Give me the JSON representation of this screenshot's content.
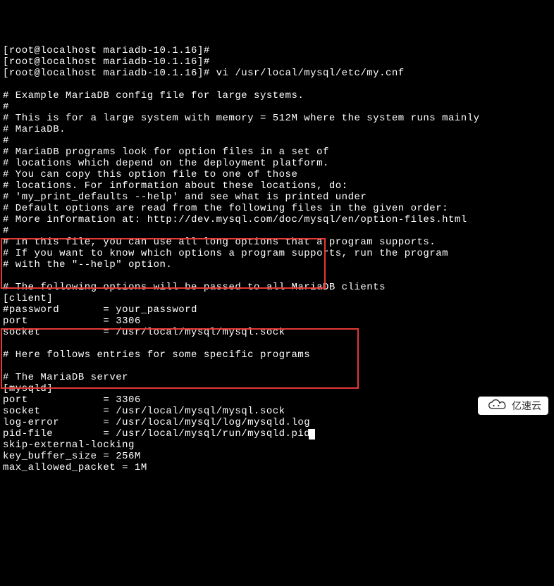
{
  "prompt": {
    "p0": "[root@localhost mariadb-10.1.16]#",
    "p1": "[root@localhost mariadb-10.1.16]#",
    "p2": "[root@localhost mariadb-10.1.16]# vi /usr/local/mysql/etc/my.cnf"
  },
  "file": {
    "l00": "",
    "l01": "# Example MariaDB config file for large systems.",
    "l02": "#",
    "l03": "# This is for a large system with memory = 512M where the system runs mainly",
    "l04": "# MariaDB.",
    "l05": "#",
    "l06": "# MariaDB programs look for option files in a set of",
    "l07": "# locations which depend on the deployment platform.",
    "l08": "# You can copy this option file to one of those",
    "l09": "# locations. For information about these locations, do:",
    "l10": "# 'my_print_defaults --help' and see what is printed under",
    "l11": "# Default options are read from the following files in the given order:",
    "l12": "# More information at: http://dev.mysql.com/doc/mysql/en/option-files.html",
    "l13": "#",
    "l14": "# In this file, you can use all long options that a program supports.",
    "l15": "# If you want to know which options a program supports, run the program",
    "l16": "# with the \"--help\" option.",
    "l17": "",
    "l18": "# The following options will be passed to all MariaDB clients",
    "l19": "[client]",
    "l20": "#password       = your_password",
    "l21": "port            = 3306",
    "l22": "socket          = /usr/local/mysql/mysql.sock",
    "l23": "",
    "l24": "# Here follows entries for some specific programs",
    "l25": "",
    "l26": "# The MariaDB server",
    "l27": "[mysqld]",
    "l28": "port            = 3306",
    "l29": "socket          = /usr/local/mysql/mysql.sock",
    "l30": "log-error       = /usr/local/mysql/log/mysqld.log",
    "l31": "pid-file        = /usr/local/mysql/run/mysqld.pid",
    "l32": "skip-external-locking",
    "l33": "key_buffer_size = 256M",
    "l34": "max_allowed_packet = 1M"
  },
  "watermark": {
    "text": "亿速云"
  }
}
